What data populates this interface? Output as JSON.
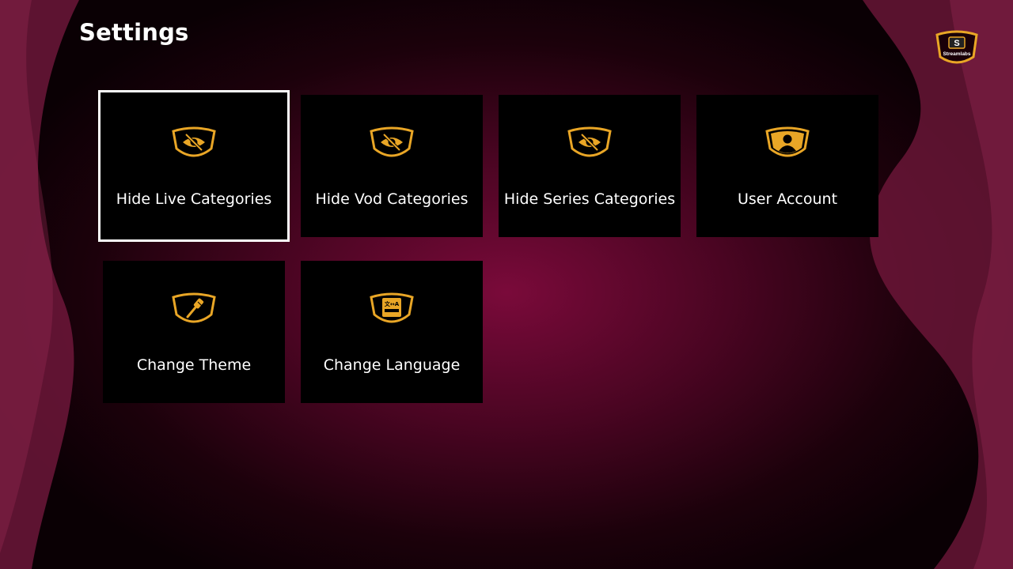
{
  "header": {
    "title": "Settings"
  },
  "logo": {
    "letter": "S",
    "text": "Streamlabs"
  },
  "colors": {
    "accent": "#e9a626",
    "tile": "#000000",
    "background": "#5a0628",
    "selected_border": "#ffffff"
  },
  "tiles": [
    {
      "label": "Hide Live Categories",
      "icon": "eye-off-icon",
      "selected": true
    },
    {
      "label": "Hide Vod Categories",
      "icon": "eye-off-icon",
      "selected": false
    },
    {
      "label": "Hide Series Categories",
      "icon": "eye-off-icon",
      "selected": false
    },
    {
      "label": "User Account",
      "icon": "user-icon",
      "selected": false
    },
    {
      "label": "Change Theme",
      "icon": "paintbrush-icon",
      "selected": false
    },
    {
      "label": "Change Language",
      "icon": "translate-icon",
      "selected": false
    }
  ]
}
